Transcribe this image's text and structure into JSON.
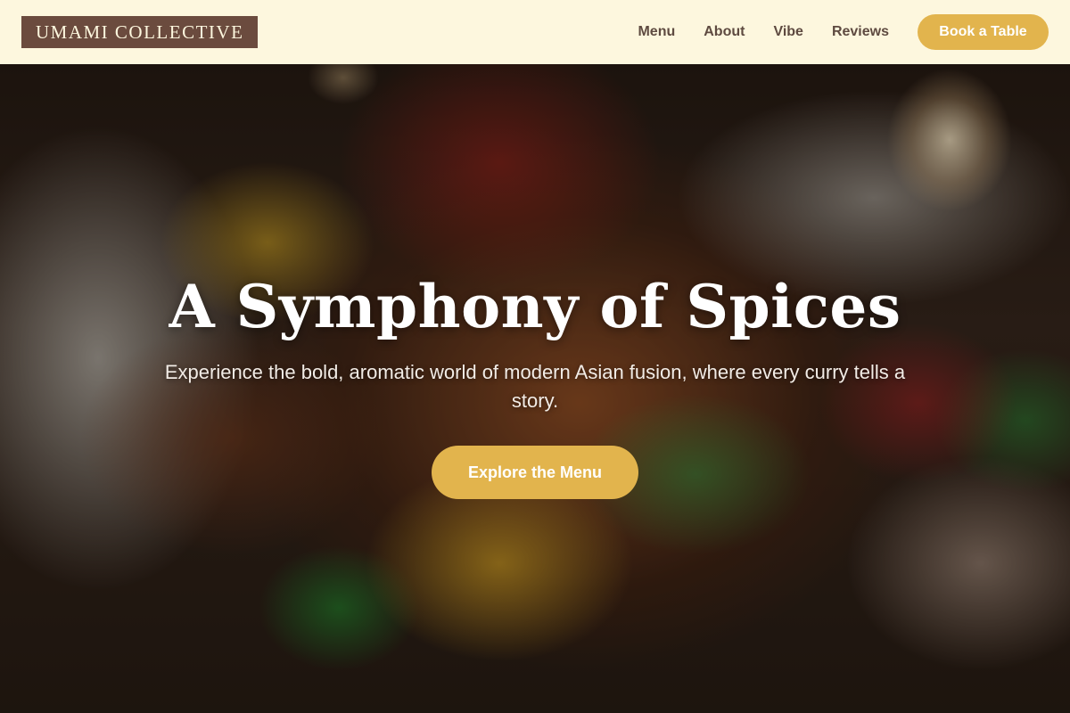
{
  "header": {
    "logo_text": "UMAMI COLLECTIVE",
    "nav": [
      {
        "label": "Menu"
      },
      {
        "label": "About"
      },
      {
        "label": "Vibe"
      },
      {
        "label": "Reviews"
      }
    ],
    "book_button_label": "Book a Table"
  },
  "hero": {
    "background_image": "stir-fry-dish-photo",
    "title": "A Symphony of Spices",
    "subtitle": "Experience the bold, aromatic world of modern Asian fusion, where every curry tells a story.",
    "cta_label": "Explore the Menu"
  },
  "colors": {
    "header_bg": "#fdf7de",
    "logo_bg": "#6b4b3e",
    "nav_text": "#5e4a40",
    "accent": "#e2b44d"
  }
}
